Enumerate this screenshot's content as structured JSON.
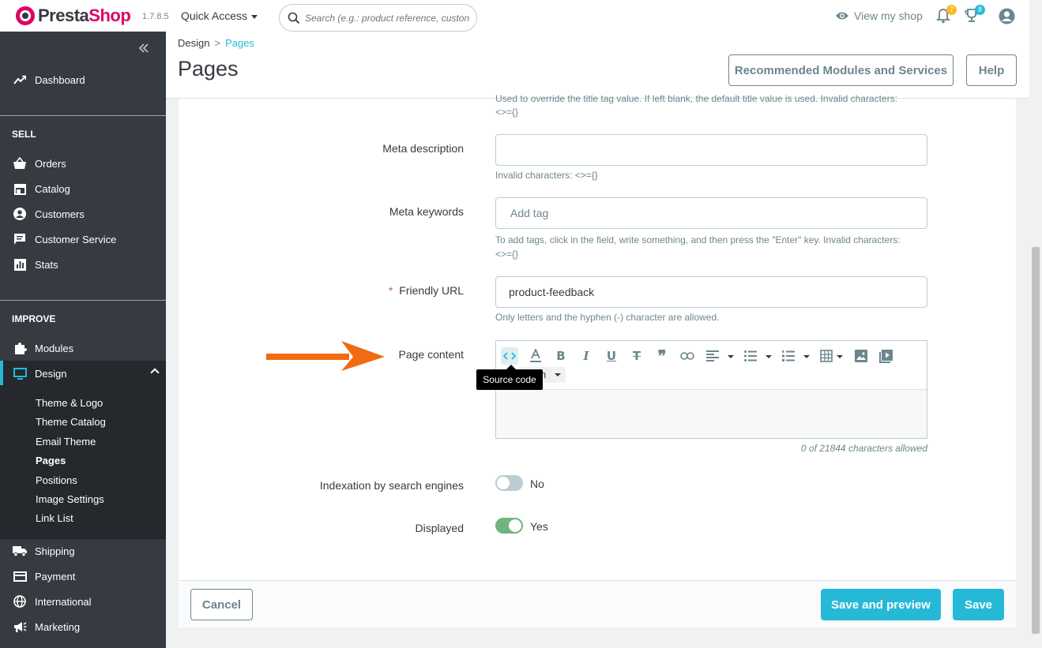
{
  "header": {
    "logo_text_a": "Presta",
    "logo_text_b": "Shop",
    "version": "1.7.8.5",
    "quick_access": "Quick Access",
    "search_placeholder": "Search (e.g.: product reference, custon",
    "view_shop": "View my shop",
    "notif_count": "7",
    "trophy_count": "8",
    "accent": "#25b9d7",
    "brand": "#df0067"
  },
  "sidebar": {
    "dashboard": "Dashboard",
    "sell_title": "SELL",
    "sell_items": [
      "Orders",
      "Catalog",
      "Customers",
      "Customer Service",
      "Stats"
    ],
    "improve_title": "IMPROVE",
    "modules": "Modules",
    "design": "Design",
    "design_sub": [
      "Theme & Logo",
      "Theme Catalog",
      "Email Theme",
      "Pages",
      "Positions",
      "Image Settings",
      "Link List"
    ],
    "more_items": [
      "Shipping",
      "Payment",
      "International",
      "Marketing"
    ]
  },
  "page": {
    "breadcrumb_parent": "Design",
    "breadcrumb_sep": ">",
    "breadcrumb_current": "Pages",
    "title": "Pages",
    "btn_recommended": "Recommended Modules and Services",
    "btn_help": "Help"
  },
  "form": {
    "meta_title_help": "Used to override the title tag value. If left blank, the default title value is used. Invalid characters:",
    "meta_title_help2": "<>={}",
    "meta_description_label": "Meta description",
    "meta_description_value": "",
    "meta_description_help": "Invalid characters: <>={}",
    "meta_keywords_label": "Meta keywords",
    "meta_keywords_placeholder": "Add tag",
    "meta_keywords_help": "To add tags, click in the field, write something, and then press the \"Enter\" key. Invalid characters:",
    "meta_keywords_help2": "<>={}",
    "friendly_url_required": "*",
    "friendly_url_label": "Friendly URL",
    "friendly_url_value": "product-feedback",
    "friendly_url_help": "Only letters and the hyphen (-) character are allowed.",
    "page_content_label": "Page content",
    "editor_format_partial": "h",
    "tooltip": "Source code",
    "char_count": "0 of 21844 characters allowed",
    "indexation_label": "Indexation by search engines",
    "indexation_value": "No",
    "displayed_label": "Displayed",
    "displayed_value": "Yes"
  },
  "footer": {
    "cancel": "Cancel",
    "save_preview": "Save and preview",
    "save": "Save"
  }
}
